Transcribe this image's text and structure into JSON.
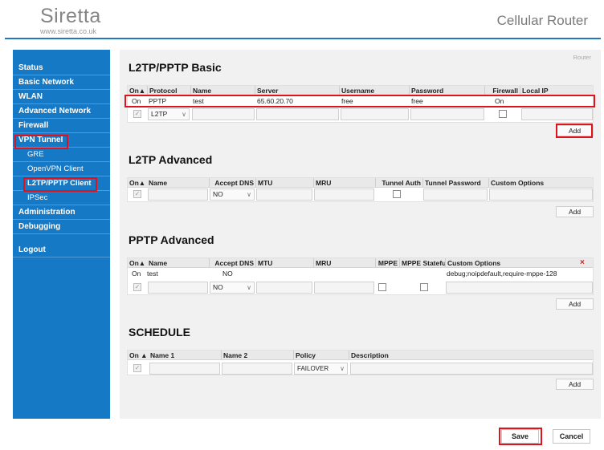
{
  "header": {
    "logo": "Siretta",
    "logo_sub": "www.siretta.co.uk",
    "title": "Cellular Router"
  },
  "sidebar": {
    "items": [
      {
        "label": "Status"
      },
      {
        "label": "Basic Network"
      },
      {
        "label": "WLAN"
      },
      {
        "label": "Advanced Network"
      },
      {
        "label": "Firewall"
      },
      {
        "label": "VPN Tunnel"
      },
      {
        "label": "GRE"
      },
      {
        "label": "OpenVPN Client"
      },
      {
        "label": "L2TP/PPTP Client"
      },
      {
        "label": "IPSec"
      },
      {
        "label": "Administration"
      },
      {
        "label": "Debugging"
      },
      {
        "label": "Logout"
      }
    ]
  },
  "main": {
    "router_label": "Router"
  },
  "basic": {
    "title": "L2TP/PPTP Basic",
    "headers": [
      "On▲",
      "Protocol",
      "Name",
      "Server",
      "Username",
      "Password",
      "Firewall",
      "Local IP"
    ],
    "row": {
      "on": "On",
      "protocol": "PPTP",
      "name": "test",
      "server": "65.60.20.70",
      "username": "free",
      "password": "free",
      "firewall": "On"
    },
    "protocol_select": "L2TP",
    "add": "Add"
  },
  "l2tp": {
    "title": "L2TP Advanced",
    "headers": [
      "On▲",
      "Name",
      "Accept DNS",
      "MTU",
      "MRU",
      "Tunnel Auth",
      "Tunnel Password",
      "Custom Options"
    ],
    "dns_select": "NO",
    "add": "Add"
  },
  "pptp": {
    "title": "PPTP Advanced",
    "headers": [
      "On▲",
      "Name",
      "Accept DNS",
      "MTU",
      "MRU",
      "MPPE",
      "MPPE Stateful",
      "Custom Options"
    ],
    "row": {
      "on": "On",
      "name": "test",
      "dns": "NO",
      "custom": "debug;noipdefault,require-mppe-128"
    },
    "dns_select": "NO",
    "delete": "×",
    "add": "Add"
  },
  "schedule": {
    "title": "SCHEDULE",
    "headers": [
      "On ▲",
      "Name 1",
      "Name 2",
      "Policy",
      "Description"
    ],
    "policy_select": "FAILOVER",
    "add": "Add"
  },
  "footer": {
    "save": "Save",
    "cancel": "Cancel"
  },
  "icons": {
    "check": "✓",
    "dropdown": "∨"
  },
  "colors": {
    "accent": "#1579c6",
    "highlight": "#e0131d"
  }
}
